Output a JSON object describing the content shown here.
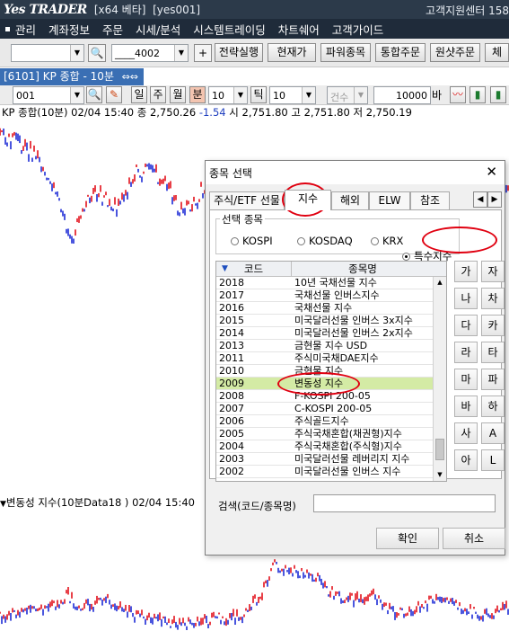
{
  "titlebar": {
    "logo": "Yes TRADER",
    "info": "[x64 베타]  [yes001]",
    "right": "고객지원센터 158"
  },
  "menu": [
    "관리",
    "계좌정보",
    "주문",
    "시세/분석",
    "시스템트레이딩",
    "차트쉐어",
    "고객가이드"
  ],
  "toolbar1": {
    "combo1_value": "",
    "combo2_value": "____4002",
    "buttons": [
      "전략실행",
      "현재가",
      "파워종목",
      "통합주문",
      "원샷주문",
      "체"
    ]
  },
  "window_tab": {
    "label": "[6101] KP 종합 - 10분",
    "glyph": "⇔⇔"
  },
  "toolbar2": {
    "code": "001",
    "periods": [
      "일",
      "주",
      "월",
      "분"
    ],
    "active_period": "분",
    "interval": "10",
    "tick_label": "틱",
    "tick_value": "10",
    "count_label": "건수",
    "count_value": "10000",
    "unit": "바"
  },
  "info_line": {
    "prefix": "KP 종합(10분) 02/04 15:40   종 2,750.26 ",
    "change": "-1.54",
    "suffix": "  시 2,751.80 고 2,751.80 저 2,750.19"
  },
  "pane2": {
    "label": "변동성 지수(10분Data18 ) 02/04 15:40"
  },
  "dialog": {
    "title": "종목 선택",
    "close": "✕",
    "tabs": [
      "주식/ETF 선물",
      "지수",
      "해외",
      "ELW",
      "참조"
    ],
    "active_tab": "지수",
    "group_label": "선택 종목",
    "radios": [
      "KOSPI",
      "KOSDAQ",
      "KRX",
      "특수지수"
    ],
    "selected_radio": "특수지수",
    "list_headers": {
      "code": "코드",
      "name": "종목명"
    },
    "rows": [
      {
        "code": "2018",
        "name": "10년 국채선물 지수"
      },
      {
        "code": "2017",
        "name": "국채선물 인버스지수"
      },
      {
        "code": "2016",
        "name": "국채선물 지수"
      },
      {
        "code": "2015",
        "name": "미국달러선물 인버스 3x지수"
      },
      {
        "code": "2014",
        "name": "미국달러선물 인버스 2x지수"
      },
      {
        "code": "2013",
        "name": "금현물 지수 USD"
      },
      {
        "code": "2011",
        "name": "주식미국채DAE지수"
      },
      {
        "code": "2010",
        "name": "금현물 지수"
      },
      {
        "code": "2009",
        "name": "변동성 지수"
      },
      {
        "code": "2008",
        "name": "F-KOSPI 200-05"
      },
      {
        "code": "2007",
        "name": "C-KOSPI 200-05"
      },
      {
        "code": "2006",
        "name": "주식골드지수"
      },
      {
        "code": "2005",
        "name": "주식국채혼합(채권형)지수"
      },
      {
        "code": "2004",
        "name": "주식국채혼합(주식형)지수"
      },
      {
        "code": "2003",
        "name": "미국달러선물 레버리지 지수"
      },
      {
        "code": "2002",
        "name": "미국달러선물 인버스 지수"
      }
    ],
    "selected_code": "2009",
    "kana_left": [
      "가",
      "나",
      "다",
      "라",
      "마",
      "바",
      "사",
      "아"
    ],
    "kana_right": [
      "자",
      "차",
      "카",
      "타",
      "파",
      "하",
      "A",
      "L"
    ],
    "search_label": "검색(코드/종목명)",
    "search_value": "",
    "ok": "확인",
    "cancel": "취소"
  },
  "colors": {
    "up": "#e3101a",
    "down": "#1d2bd6",
    "highlight": "#e00010",
    "selected_row": "#d4eba5"
  }
}
